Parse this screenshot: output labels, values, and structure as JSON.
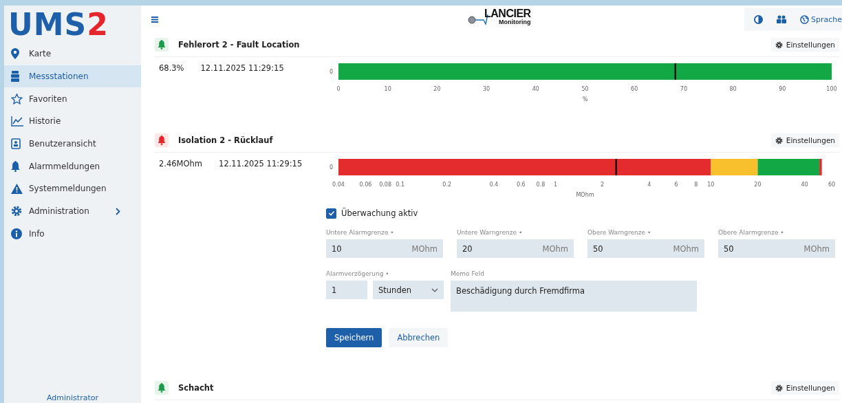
{
  "sidebar": {
    "logo": {
      "main": "UMS",
      "accent": "2"
    },
    "items": [
      {
        "kind": "map",
        "label": "Karte",
        "selected": false
      },
      {
        "kind": "stations",
        "label": "Messstationen",
        "selected": true
      },
      {
        "kind": "favorites",
        "label": "Favoriten",
        "selected": false
      },
      {
        "kind": "history",
        "label": "Historie",
        "selected": false
      },
      {
        "kind": "userview",
        "label": "Benutzeransicht",
        "selected": false
      },
      {
        "kind": "alarms",
        "label": "Alarmmeldungen",
        "selected": false
      },
      {
        "kind": "system",
        "label": "Systemmeldungen",
        "selected": false
      },
      {
        "kind": "admin",
        "label": "Administration",
        "selected": false,
        "expandable": true
      },
      {
        "kind": "info",
        "label": "Info",
        "selected": false
      }
    ],
    "footer": "Administrator"
  },
  "header": {
    "brand": {
      "name": "LANCIER",
      "sub": "Monitoring"
    },
    "actions": [
      {
        "kind": "contrast"
      },
      {
        "kind": "users"
      },
      {
        "kind": "language",
        "label": "Sprache"
      }
    ]
  },
  "sensors": [
    {
      "alarm": false,
      "title": "Fehlerort 2 - Fault Location",
      "value": "68.3%",
      "timestamp": "12.11.2025 11:29:15",
      "settings_label": "Einstellungen",
      "chart_data": {
        "type": "bar",
        "orientation": "horizontal",
        "categories": [
          "0"
        ],
        "xlabel": "%",
        "xlim": [
          0,
          100
        ],
        "series": [
          {
            "color": "#12a845",
            "values": [
              100
            ]
          }
        ],
        "xticks": [
          0,
          10,
          20,
          30,
          40,
          50,
          60,
          70,
          80,
          90,
          100
        ],
        "ref_lines": [
          {
            "axis": "x",
            "value": 68.3
          }
        ]
      }
    },
    {
      "alarm": true,
      "title": "Isolation 2 - Rücklauf",
      "value": "2.46MOhm",
      "timestamp": "12.11.2025 11:29:15",
      "settings_label": "Einstellungen",
      "gauge": {
        "row_label": "0",
        "unit": "MOhm",
        "zones": [
          {
            "color": "#e42b2d"
          },
          {
            "color": "#f7c02c"
          },
          {
            "color": "#12a845"
          },
          {
            "color": "#e42b2d"
          }
        ],
        "scale": [
          "0.04",
          "0.06",
          "0.08",
          "0.1",
          "0.2",
          "0.4",
          "0.6",
          "0.8",
          "1",
          "2",
          "4",
          "6",
          "8",
          "10",
          "20",
          "40",
          "60"
        ]
      },
      "form": {
        "monitoring": {
          "label": "Überwachung aktiv",
          "checked": true
        },
        "limits": [
          {
            "label": "Untere Alarmgrenze •",
            "value": "10",
            "unit": "MOhm"
          },
          {
            "label": "Untere Warngrenze •",
            "value": "20",
            "unit": "MOhm"
          },
          {
            "label": "Obere Warngrenze •",
            "value": "50",
            "unit": "MOhm"
          },
          {
            "label": "Obere Alarmgrenze •",
            "value": "50",
            "unit": "MOhm"
          }
        ],
        "delay": {
          "label": "Alarmverzögerung •",
          "value": "1",
          "unit": "Stunden"
        },
        "memo": {
          "label": "Memo Feld",
          "value": "Beschädigung durch Fremdfirma"
        },
        "buttons": [
          {
            "label": "Speichern",
            "kind": "primary"
          },
          {
            "label": "Abbrechen",
            "kind": "secondary"
          }
        ]
      }
    },
    {
      "alarm": false,
      "title": "Schacht",
      "settings_label": "Einstellungen"
    }
  ]
}
